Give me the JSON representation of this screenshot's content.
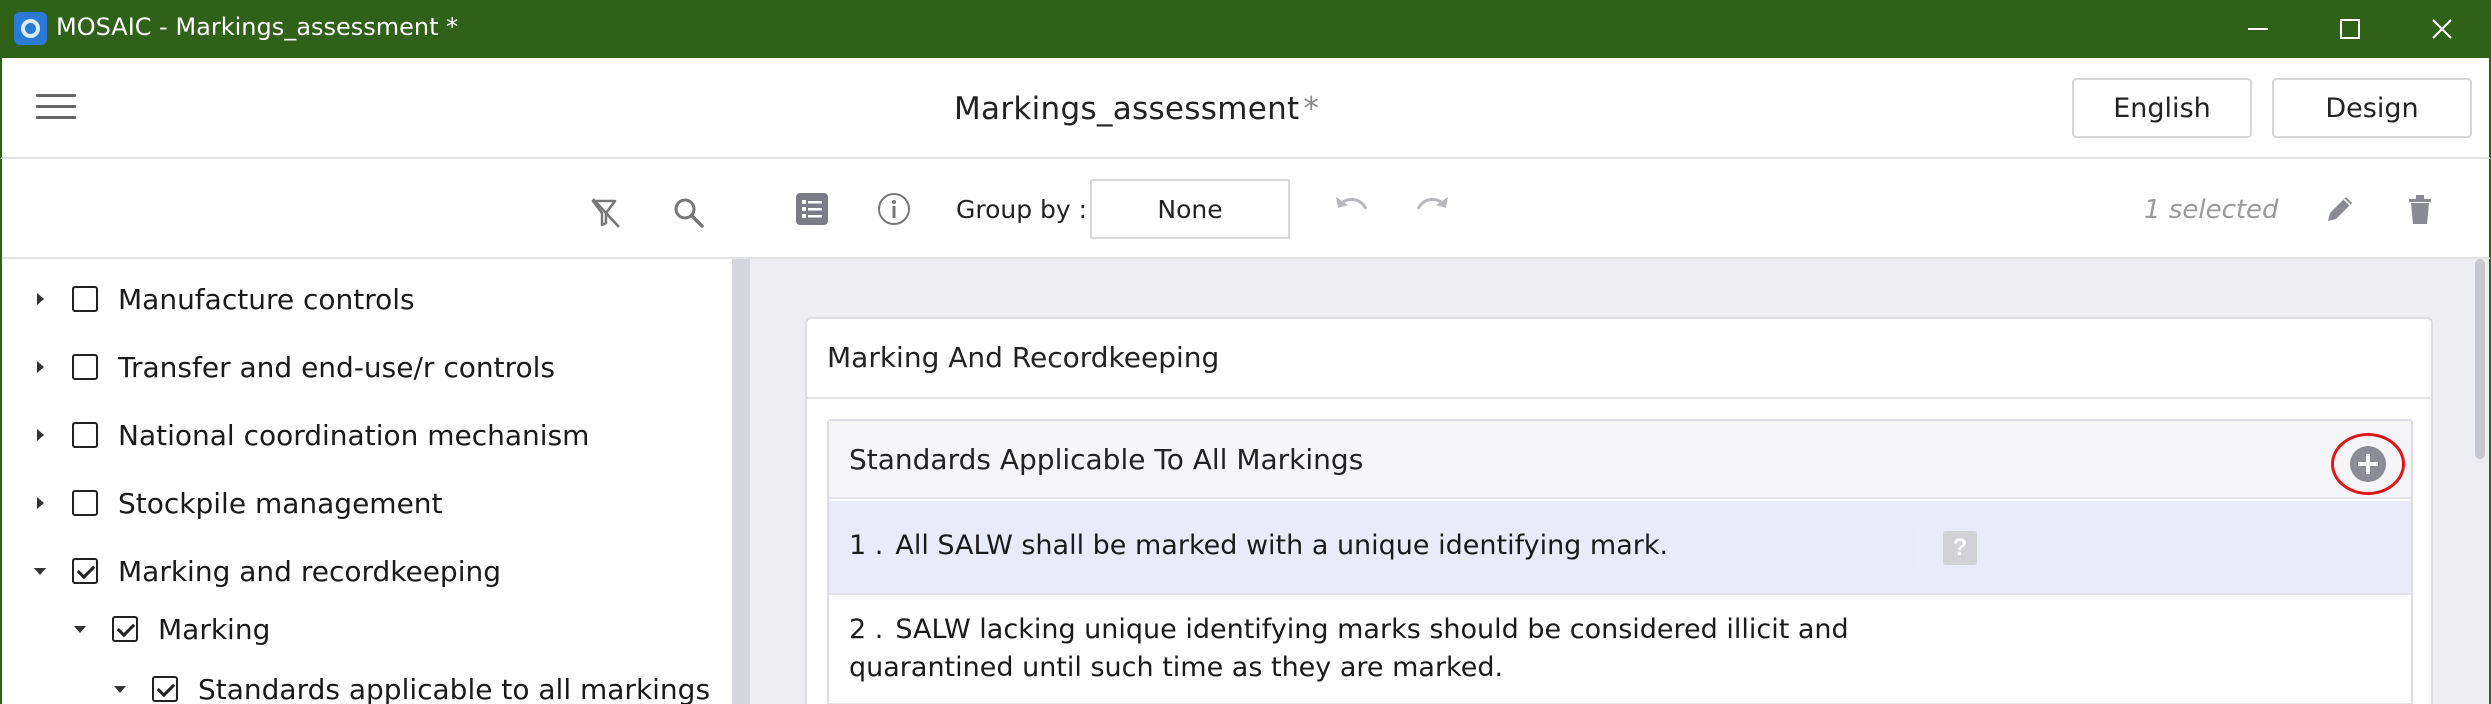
{
  "window": {
    "title": "MOSAIC - Markings_assessment *",
    "titlebar_color": "#2f6119"
  },
  "header": {
    "document_name": "Markings_assessment",
    "modified_marker": "*",
    "language_button": "English",
    "design_button": "Design"
  },
  "left_panel": {
    "icons": [
      "filter-clear-icon",
      "search-icon"
    ],
    "tree": [
      {
        "label": "Manufacture controls",
        "expanded": false,
        "checked": false,
        "level": 0
      },
      {
        "label": "Transfer and end-use/r controls",
        "expanded": false,
        "checked": false,
        "level": 0
      },
      {
        "label": "National coordination mechanism",
        "expanded": false,
        "checked": false,
        "level": 0
      },
      {
        "label": "Stockpile management",
        "expanded": false,
        "checked": false,
        "level": 0
      },
      {
        "label": "Marking and recordkeeping",
        "expanded": true,
        "checked": true,
        "level": 0
      },
      {
        "label": "Marking",
        "expanded": true,
        "checked": true,
        "level": 1
      },
      {
        "label": "Standards applicable to all markings",
        "expanded": true,
        "checked": true,
        "level": 2
      }
    ]
  },
  "toolbar": {
    "group_by_label": "Group by :",
    "group_by_value": "None",
    "selected_count": "1 selected"
  },
  "content": {
    "section_title": "Marking And Recordkeeping",
    "subsection_title": "Standards Applicable To All Markings",
    "items": [
      {
        "number": "1 .",
        "text": "All SALW shall be marked with a unique identifying mark.",
        "selected": true,
        "help": "?"
      },
      {
        "number": "2 .",
        "text": "SALW lacking unique identifying marks should be considered illicit and quarantined until such time as they are marked.",
        "selected": false
      }
    ]
  }
}
